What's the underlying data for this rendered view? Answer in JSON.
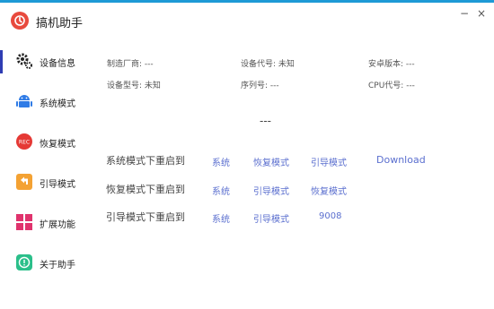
{
  "app": {
    "title": "搞机助手"
  },
  "window": {
    "minimize": "−",
    "close": "×"
  },
  "sidebar": {
    "items": [
      {
        "label": "设备信息",
        "icon": "gear-icon"
      },
      {
        "label": "系统模式",
        "icon": "android-icon"
      },
      {
        "label": "恢复模式",
        "icon": "rec-icon",
        "badge": "REC"
      },
      {
        "label": "引导模式",
        "icon": "back-arrow-icon"
      },
      {
        "label": "扩展功能",
        "icon": "grid-icon"
      },
      {
        "label": "关于助手",
        "icon": "info-icon"
      }
    ]
  },
  "device_info": {
    "manufacturer": "制造厂商: ---",
    "device_code": "设备代号: 未知",
    "android_version": "安卓版本: ---",
    "device_model": "设备型号: 未知",
    "serial": "序列号: ---",
    "cpu_code": "CPU代号: ---"
  },
  "status_text": "---",
  "reboot_rows": [
    {
      "label": "系统模式下重启到",
      "links": [
        "系统",
        "恢复模式",
        "引导模式",
        "Download"
      ]
    },
    {
      "label": "恢复模式下重启到",
      "links": [
        "系统",
        "引导模式",
        "恢复模式"
      ]
    },
    {
      "label": "引导模式下重启到",
      "links": [
        "系统",
        "引导模式",
        "9008"
      ]
    }
  ],
  "colors": {
    "accent": "#1e9ad6",
    "active_marker": "#2f3db3",
    "link": "#5b6fcf",
    "android": "#2f7be6",
    "rec": "#e53935",
    "back": "#f4a233",
    "grid": "#e0336d",
    "info": "#2bbf8a"
  }
}
